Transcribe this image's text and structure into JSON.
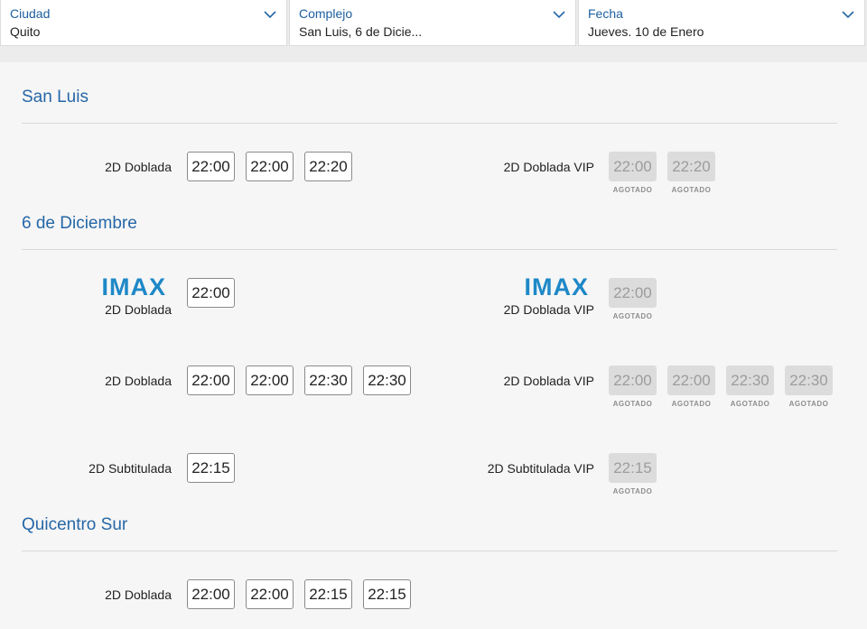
{
  "filters": {
    "ciudad": {
      "label": "Ciudad",
      "value": "Quito"
    },
    "complejo": {
      "label": "Complejo",
      "value": "San Luis, 6 de Dicie..."
    },
    "fecha": {
      "label": "Fecha",
      "value": "Jueves. 10 de Enero"
    }
  },
  "soldout_label": "AGOTADO",
  "imax_logo_text": "IMAX",
  "cinemas": [
    {
      "name": "San Luis",
      "rows": [
        {
          "left": {
            "format": "2D Doblada",
            "times": [
              "22:00",
              "22:00",
              "22:20"
            ]
          },
          "right": {
            "format": "2D Doblada VIP",
            "times": [
              "22:00",
              "22:20"
            ],
            "soldout": true
          }
        }
      ]
    },
    {
      "name": "6 de Diciembre",
      "rows": [
        {
          "left": {
            "format": "2D Doblada",
            "imax": true,
            "times": [
              "22:00"
            ]
          },
          "right": {
            "format": "2D Doblada VIP",
            "imax": true,
            "times": [
              "22:00"
            ],
            "soldout": true
          }
        },
        {
          "left": {
            "format": "2D Doblada",
            "times": [
              "22:00",
              "22:00",
              "22:30",
              "22:30"
            ]
          },
          "right": {
            "format": "2D Doblada VIP",
            "times": [
              "22:00",
              "22:00",
              "22:30",
              "22:30"
            ],
            "soldout": true
          }
        },
        {
          "left": {
            "format": "2D Subtitulada",
            "times": [
              "22:15"
            ]
          },
          "right": {
            "format": "2D Subtitulada VIP",
            "times": [
              "22:15"
            ],
            "soldout": true
          }
        }
      ]
    },
    {
      "name": "Quicentro Sur",
      "rows": [
        {
          "left": {
            "format": "2D Doblada",
            "times": [
              "22:00",
              "22:00",
              "22:15",
              "22:15"
            ]
          }
        }
      ]
    }
  ],
  "colors": {
    "accent": "#2667a7",
    "imax": "#1e88c7",
    "soldout_bg": "#dcdcdc"
  }
}
